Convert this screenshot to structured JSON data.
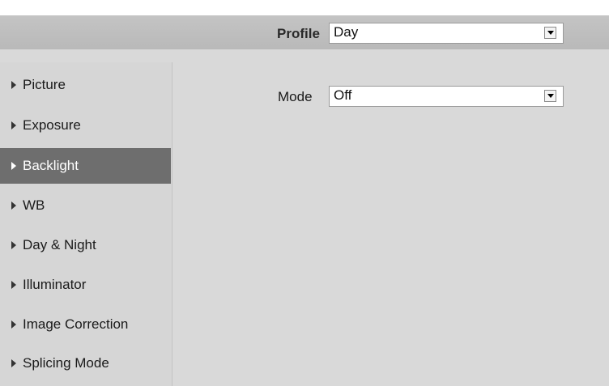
{
  "profile": {
    "label": "Profile",
    "value": "Day"
  },
  "sidebar": {
    "items": [
      {
        "label": "Picture"
      },
      {
        "label": "Exposure"
      },
      {
        "label": "Backlight",
        "active": true
      },
      {
        "label": "WB"
      },
      {
        "label": "Day & Night"
      },
      {
        "label": "Illuminator"
      },
      {
        "label": "Image Correction"
      },
      {
        "label": "Splicing Mode"
      }
    ]
  },
  "mode": {
    "label": "Mode",
    "value": "Off"
  },
  "colors": {
    "active_item_bg": "#6e6e6e",
    "panel_bg": "#d9d9d9",
    "header_bg": "#bfbfbf"
  }
}
